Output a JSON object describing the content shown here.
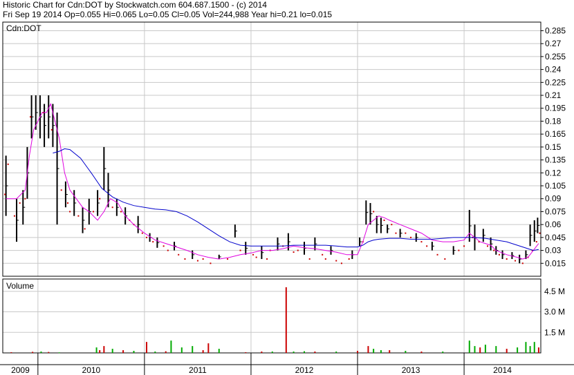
{
  "header": {
    "line1": "Historic Chart for Cdn:DOT by Stockwatch.com 604.687.1500 - (c) 2014",
    "line2": "Fri Sep 19 2014  Op=0.055  Hi=0.065  Lo=0.05  Cl=0.05  Vol=244,988  Year hi=0.21  lo=0.015"
  },
  "colors": {
    "price_bar": "#000000",
    "price_dot": "#cc0000",
    "ma_short": "#e000e0",
    "ma_long": "#0000cc",
    "volume_up": "#00aa00",
    "volume_down": "#cc0000",
    "grid": "#c8c8c8"
  },
  "chart_data": [
    {
      "type": "line",
      "title": "Cdn:DOT",
      "ylim": [
        0.0,
        0.295
      ],
      "y_ticks": [
        "0.285",
        "0.27",
        "0.255",
        "0.24",
        "0.225",
        "0.21",
        "0.195",
        "0.18",
        "0.165",
        "0.15",
        "0.135",
        "0.12",
        "0.105",
        "0.09",
        "0.075",
        "0.06",
        "0.045",
        "0.03",
        "0.015"
      ],
      "x_labels": [
        "2009",
        "2010",
        "2011",
        "2012",
        "2013",
        "2014"
      ],
      "xlim": [
        2009.67,
        2014.72
      ],
      "year_boundaries": [
        2010.0,
        2011.0,
        2012.0,
        2013.0,
        2014.0
      ],
      "price_ranges": [
        [
          2009.7,
          0.07,
          0.14
        ],
        [
          2009.8,
          0.04,
          0.09
        ],
        [
          2009.86,
          0.06,
          0.1
        ],
        [
          2009.9,
          0.09,
          0.15
        ],
        [
          2009.94,
          0.16,
          0.21
        ],
        [
          2009.98,
          0.17,
          0.21
        ],
        [
          2010.02,
          0.16,
          0.21
        ],
        [
          2010.06,
          0.15,
          0.2
        ],
        [
          2010.1,
          0.16,
          0.21
        ],
        [
          2010.14,
          0.15,
          0.2
        ],
        [
          2010.18,
          0.06,
          0.19
        ],
        [
          2010.26,
          0.08,
          0.11
        ],
        [
          2010.34,
          0.07,
          0.1
        ],
        [
          2010.42,
          0.05,
          0.08
        ],
        [
          2010.48,
          0.06,
          0.09
        ],
        [
          2010.56,
          0.07,
          0.1
        ],
        [
          2010.62,
          0.1,
          0.15
        ],
        [
          2010.66,
          0.08,
          0.12
        ],
        [
          2010.74,
          0.07,
          0.09
        ],
        [
          2010.82,
          0.06,
          0.08
        ],
        [
          2010.94,
          0.05,
          0.07
        ],
        [
          2011.05,
          0.04,
          0.05
        ],
        [
          2011.12,
          0.033,
          0.045
        ],
        [
          2011.28,
          0.03,
          0.04
        ],
        [
          2011.45,
          0.02,
          0.03
        ],
        [
          2011.7,
          0.02,
          0.025
        ],
        [
          2011.85,
          0.045,
          0.06
        ],
        [
          2011.95,
          0.025,
          0.04
        ],
        [
          2012.1,
          0.02,
          0.035
        ],
        [
          2012.25,
          0.03,
          0.045
        ],
        [
          2012.35,
          0.03,
          0.05
        ],
        [
          2012.5,
          0.025,
          0.04
        ],
        [
          2012.6,
          0.03,
          0.045
        ],
        [
          2012.75,
          0.025,
          0.035
        ],
        [
          2012.95,
          0.02,
          0.03
        ],
        [
          2013.02,
          0.035,
          0.045
        ],
        [
          2013.08,
          0.06,
          0.088
        ],
        [
          2013.12,
          0.06,
          0.085
        ],
        [
          2013.18,
          0.05,
          0.07
        ],
        [
          2013.22,
          0.05,
          0.068
        ],
        [
          2013.28,
          0.05,
          0.06
        ],
        [
          2013.4,
          0.045,
          0.055
        ],
        [
          2013.55,
          0.04,
          0.05
        ],
        [
          2013.7,
          0.03,
          0.04
        ],
        [
          2013.9,
          0.025,
          0.035
        ],
        [
          2014.05,
          0.04,
          0.077
        ],
        [
          2014.1,
          0.03,
          0.06
        ],
        [
          2014.18,
          0.04,
          0.055
        ],
        [
          2014.25,
          0.03,
          0.045
        ],
        [
          2014.3,
          0.025,
          0.035
        ],
        [
          2014.36,
          0.02,
          0.03
        ],
        [
          2014.45,
          0.02,
          0.028
        ],
        [
          2014.52,
          0.015,
          0.025
        ],
        [
          2014.58,
          0.02,
          0.03
        ],
        [
          2014.62,
          0.035,
          0.06
        ],
        [
          2014.66,
          0.04,
          0.065
        ],
        [
          2014.69,
          0.05,
          0.068
        ]
      ],
      "price_dots": [
        [
          2009.69,
          0.095
        ],
        [
          2009.72,
          0.13
        ],
        [
          2009.78,
          0.07
        ],
        [
          2009.83,
          0.085
        ],
        [
          2009.88,
          0.09
        ],
        [
          2009.93,
          0.185
        ],
        [
          2010.05,
          0.19
        ],
        [
          2010.13,
          0.17
        ],
        [
          2010.22,
          0.1
        ],
        [
          2010.28,
          0.085
        ],
        [
          2010.3,
          0.075
        ],
        [
          2010.38,
          0.07
        ],
        [
          2010.44,
          0.055
        ],
        [
          2010.52,
          0.075
        ],
        [
          2010.58,
          0.09
        ],
        [
          2010.7,
          0.08
        ],
        [
          2010.78,
          0.075
        ],
        [
          2010.86,
          0.065
        ],
        [
          2010.9,
          0.06
        ],
        [
          2010.98,
          0.05
        ],
        [
          2011.02,
          0.045
        ],
        [
          2011.08,
          0.04
        ],
        [
          2011.18,
          0.035
        ],
        [
          2011.22,
          0.03
        ],
        [
          2011.32,
          0.025
        ],
        [
          2011.38,
          0.02
        ],
        [
          2011.5,
          0.018
        ],
        [
          2011.55,
          0.02
        ],
        [
          2011.62,
          0.015
        ],
        [
          2011.78,
          0.02
        ],
        [
          2011.9,
          0.03
        ],
        [
          2012.02,
          0.025
        ],
        [
          2012.05,
          0.022
        ],
        [
          2012.15,
          0.02
        ],
        [
          2012.18,
          0.03
        ],
        [
          2012.3,
          0.035
        ],
        [
          2012.4,
          0.028
        ],
        [
          2012.44,
          0.03
        ],
        [
          2012.55,
          0.02
        ],
        [
          2012.67,
          0.025
        ],
        [
          2012.7,
          0.02
        ],
        [
          2012.8,
          0.018
        ],
        [
          2012.85,
          0.015
        ],
        [
          2012.92,
          0.02
        ],
        [
          2013.05,
          0.04
        ],
        [
          2013.15,
          0.075
        ],
        [
          2013.25,
          0.065
        ],
        [
          2013.32,
          0.06
        ],
        [
          2013.36,
          0.05
        ],
        [
          2013.45,
          0.05
        ],
        [
          2013.5,
          0.045
        ],
        [
          2013.6,
          0.04
        ],
        [
          2013.65,
          0.035
        ],
        [
          2013.75,
          0.025
        ],
        [
          2013.82,
          0.02
        ],
        [
          2013.95,
          0.03
        ],
        [
          2014.0,
          0.035
        ],
        [
          2014.08,
          0.045
        ],
        [
          2014.14,
          0.04
        ],
        [
          2014.22,
          0.035
        ],
        [
          2014.28,
          0.03
        ],
        [
          2014.33,
          0.025
        ],
        [
          2014.4,
          0.02
        ],
        [
          2014.48,
          0.018
        ],
        [
          2014.55,
          0.015
        ],
        [
          2014.6,
          0.022
        ],
        [
          2014.64,
          0.03
        ],
        [
          2014.68,
          0.04
        ],
        [
          2014.71,
          0.05
        ]
      ],
      "series": [
        {
          "key": "ma_short",
          "x": [
            2009.7,
            2009.8,
            2009.88,
            2009.92,
            2009.96,
            2010.0,
            2010.04,
            2010.08,
            2010.12,
            2010.16,
            2010.2,
            2010.25,
            2010.3,
            2010.36,
            2010.42,
            2010.48,
            2010.52,
            2010.56,
            2010.62,
            2010.68,
            2010.75,
            2010.82,
            2010.9,
            2011.0,
            2011.1,
            2011.2,
            2011.3,
            2011.4,
            2011.5,
            2011.6,
            2011.7,
            2011.8,
            2011.9,
            2012.0,
            2012.1,
            2012.2,
            2012.3,
            2012.4,
            2012.5,
            2012.6,
            2012.7,
            2012.8,
            2012.9,
            2013.0,
            2013.05,
            2013.1,
            2013.15,
            2013.2,
            2013.25,
            2013.3,
            2013.4,
            2013.5,
            2013.6,
            2013.7,
            2013.8,
            2013.9,
            2014.0,
            2014.05,
            2014.1,
            2014.15,
            2014.2,
            2014.25,
            2014.3,
            2014.4,
            2014.5,
            2014.55,
            2014.6,
            2014.65,
            2014.7
          ],
          "y": [
            0.09,
            0.09,
            0.1,
            0.14,
            0.17,
            0.18,
            0.19,
            0.19,
            0.2,
            0.18,
            0.16,
            0.12,
            0.1,
            0.09,
            0.08,
            0.075,
            0.07,
            0.065,
            0.075,
            0.09,
            0.085,
            0.07,
            0.06,
            0.05,
            0.042,
            0.038,
            0.034,
            0.03,
            0.025,
            0.022,
            0.02,
            0.022,
            0.025,
            0.027,
            0.03,
            0.03,
            0.032,
            0.035,
            0.033,
            0.032,
            0.03,
            0.028,
            0.025,
            0.025,
            0.04,
            0.06,
            0.065,
            0.07,
            0.068,
            0.065,
            0.06,
            0.055,
            0.05,
            0.042,
            0.04,
            0.04,
            0.042,
            0.05,
            0.045,
            0.04,
            0.038,
            0.036,
            0.03,
            0.025,
            0.022,
            0.02,
            0.022,
            0.03,
            0.038
          ]
        },
        {
          "key": "ma_long",
          "x": [
            2010.14,
            2010.2,
            2010.25,
            2010.3,
            2010.4,
            2010.5,
            2010.6,
            2010.7,
            2010.8,
            2010.9,
            2011.0,
            2011.1,
            2011.2,
            2011.3,
            2011.4,
            2011.5,
            2011.6,
            2011.7,
            2011.8,
            2011.9,
            2012.0,
            2012.1,
            2012.2,
            2012.3,
            2012.4,
            2012.5,
            2012.6,
            2012.7,
            2012.8,
            2012.9,
            2013.0,
            2013.05,
            2013.1,
            2013.15,
            2013.2,
            2013.3,
            2013.4,
            2013.5,
            2013.6,
            2013.7,
            2013.8,
            2013.9,
            2014.0,
            2014.1,
            2014.2,
            2014.3,
            2014.4,
            2014.5,
            2014.6,
            2014.65,
            2014.7
          ],
          "y": [
            0.143,
            0.145,
            0.148,
            0.147,
            0.137,
            0.12,
            0.102,
            0.092,
            0.086,
            0.082,
            0.08,
            0.078,
            0.077,
            0.075,
            0.07,
            0.063,
            0.055,
            0.047,
            0.04,
            0.036,
            0.035,
            0.035,
            0.035,
            0.035,
            0.036,
            0.036,
            0.036,
            0.036,
            0.035,
            0.034,
            0.034,
            0.036,
            0.04,
            0.042,
            0.043,
            0.044,
            0.044,
            0.043,
            0.043,
            0.043,
            0.044,
            0.045,
            0.045,
            0.045,
            0.044,
            0.042,
            0.04,
            0.036,
            0.032,
            0.03,
            0.031
          ]
        }
      ]
    },
    {
      "type": "bar",
      "title": "Volume",
      "ylim": [
        0,
        5.4
      ],
      "y_ticks": [
        "4.5 M",
        "3.0 M",
        "1.5 M"
      ],
      "y_tick_values": [
        4.5,
        3.0,
        1.5
      ],
      "x_labels": [
        "2009",
        "2010",
        "2011",
        "2012",
        "2013",
        "2014"
      ],
      "bars": [
        [
          2009.75,
          0.05,
          "down"
        ],
        [
          2009.95,
          0.08,
          "down"
        ],
        [
          2010.03,
          0.1,
          "up"
        ],
        [
          2010.1,
          0.07,
          "down"
        ],
        [
          2010.2,
          0.04,
          "up"
        ],
        [
          2010.55,
          0.4,
          "up"
        ],
        [
          2010.58,
          0.2,
          "down"
        ],
        [
          2010.62,
          0.5,
          "down"
        ],
        [
          2010.7,
          0.3,
          "up"
        ],
        [
          2010.8,
          0.2,
          "down"
        ],
        [
          2010.9,
          0.15,
          "up"
        ],
        [
          2011.02,
          0.8,
          "down"
        ],
        [
          2011.1,
          0.1,
          "up"
        ],
        [
          2011.2,
          0.12,
          "down"
        ],
        [
          2011.25,
          0.9,
          "up"
        ],
        [
          2011.35,
          0.4,
          "up"
        ],
        [
          2011.45,
          0.5,
          "up"
        ],
        [
          2011.55,
          0.2,
          "down"
        ],
        [
          2011.6,
          0.7,
          "down"
        ],
        [
          2011.7,
          0.3,
          "up"
        ],
        [
          2011.95,
          0.05,
          "down"
        ],
        [
          2012.1,
          0.1,
          "down"
        ],
        [
          2012.2,
          0.1,
          "up"
        ],
        [
          2012.33,
          4.8,
          "down"
        ],
        [
          2012.4,
          0.1,
          "up"
        ],
        [
          2012.5,
          0.12,
          "up"
        ],
        [
          2012.6,
          0.1,
          "down"
        ],
        [
          2012.8,
          0.1,
          "up"
        ],
        [
          2013.0,
          0.15,
          "down"
        ],
        [
          2013.1,
          0.5,
          "down"
        ],
        [
          2013.15,
          0.3,
          "up"
        ],
        [
          2013.22,
          0.2,
          "up"
        ],
        [
          2013.3,
          0.2,
          "down"
        ],
        [
          2013.45,
          0.15,
          "up"
        ],
        [
          2013.6,
          0.1,
          "down"
        ],
        [
          2013.8,
          0.1,
          "up"
        ],
        [
          2014.05,
          0.9,
          "up"
        ],
        [
          2014.1,
          0.5,
          "up"
        ],
        [
          2014.15,
          0.4,
          "down"
        ],
        [
          2014.2,
          0.6,
          "up"
        ],
        [
          2014.3,
          0.5,
          "up"
        ],
        [
          2014.4,
          0.3,
          "down"
        ],
        [
          2014.5,
          0.4,
          "up"
        ],
        [
          2014.58,
          0.8,
          "up"
        ],
        [
          2014.62,
          0.5,
          "up"
        ],
        [
          2014.66,
          0.8,
          "up"
        ],
        [
          2014.7,
          0.4,
          "down"
        ]
      ]
    }
  ]
}
